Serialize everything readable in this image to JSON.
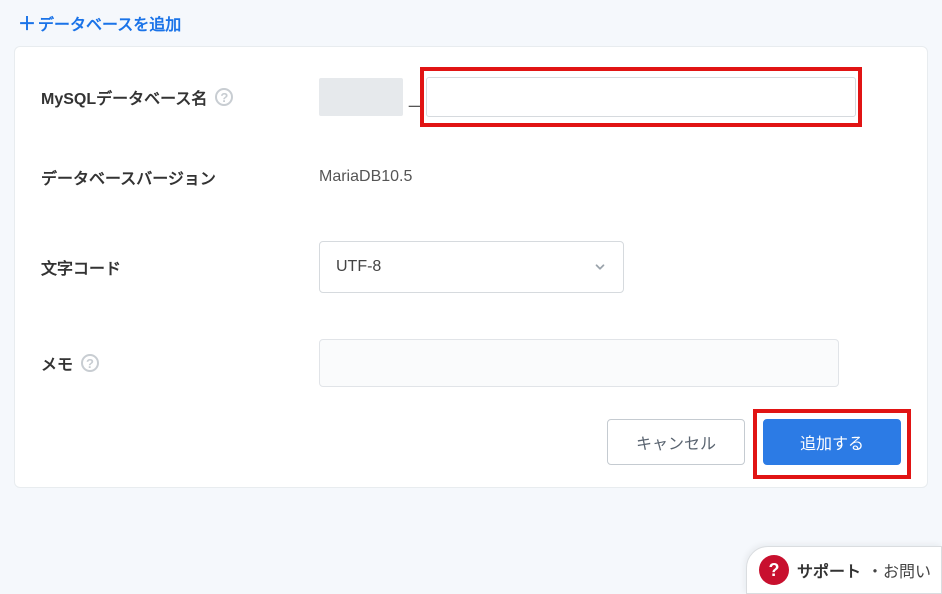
{
  "header": {
    "add_database_label": "データベースを追加"
  },
  "form": {
    "db_name": {
      "label": "MySQLデータベース名",
      "prefix": "",
      "separator": "_",
      "value": ""
    },
    "db_version": {
      "label": "データベースバージョン",
      "value": "MariaDB10.5"
    },
    "charset": {
      "label": "文字コード",
      "selected": "UTF-8"
    },
    "memo": {
      "label": "メモ",
      "value": ""
    }
  },
  "buttons": {
    "cancel": "キャンセル",
    "submit": "追加する"
  },
  "support": {
    "label": "サポート",
    "sub": "・お問い"
  }
}
